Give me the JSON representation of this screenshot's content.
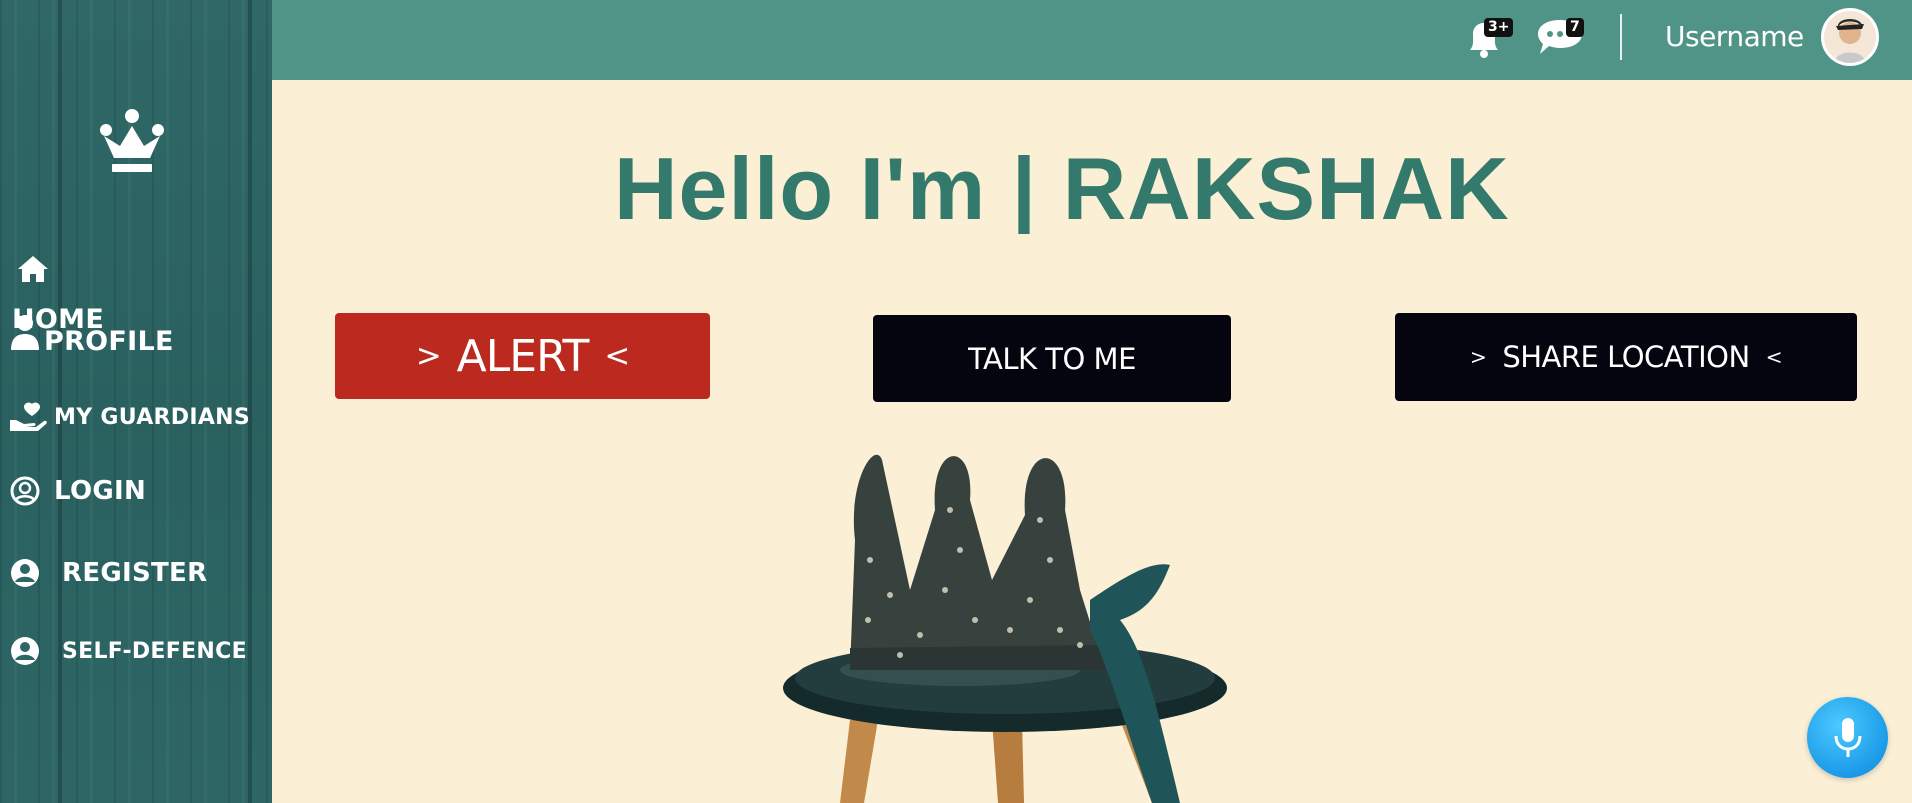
{
  "sidebar": {
    "logo_icon": "crown-icon",
    "items": [
      {
        "label": "HOME",
        "icon": "home-icon"
      },
      {
        "label": "PROFILE",
        "icon": "user-icon"
      },
      {
        "label": "MY GUARDIANS",
        "icon": "hand-heart-icon"
      },
      {
        "label": "LOGIN",
        "icon": "user-circle-icon"
      },
      {
        "label": "REGISTER",
        "icon": "user-circle-filled-icon"
      },
      {
        "label": "SELF-DEFENCE",
        "icon": "user-circle-filled-icon"
      }
    ]
  },
  "topbar": {
    "notifications_badge": "3+",
    "messages_badge": "7",
    "username": "Username",
    "background": "#4f9486"
  },
  "hero": {
    "title": "Hello I'm | RAKSHAK"
  },
  "actions": {
    "alert": {
      "prefix": ">",
      "label": "ALERT",
      "suffix": "<"
    },
    "talk": {
      "label": "TALK TO ME"
    },
    "share": {
      "prefix": ">",
      "label": "SHARE LOCATION",
      "suffix": "<"
    }
  },
  "colors": {
    "accent": "#347a6c",
    "alert": "#bc2a1f",
    "dark_button": "#05050f",
    "mic": "#1b9be8"
  }
}
